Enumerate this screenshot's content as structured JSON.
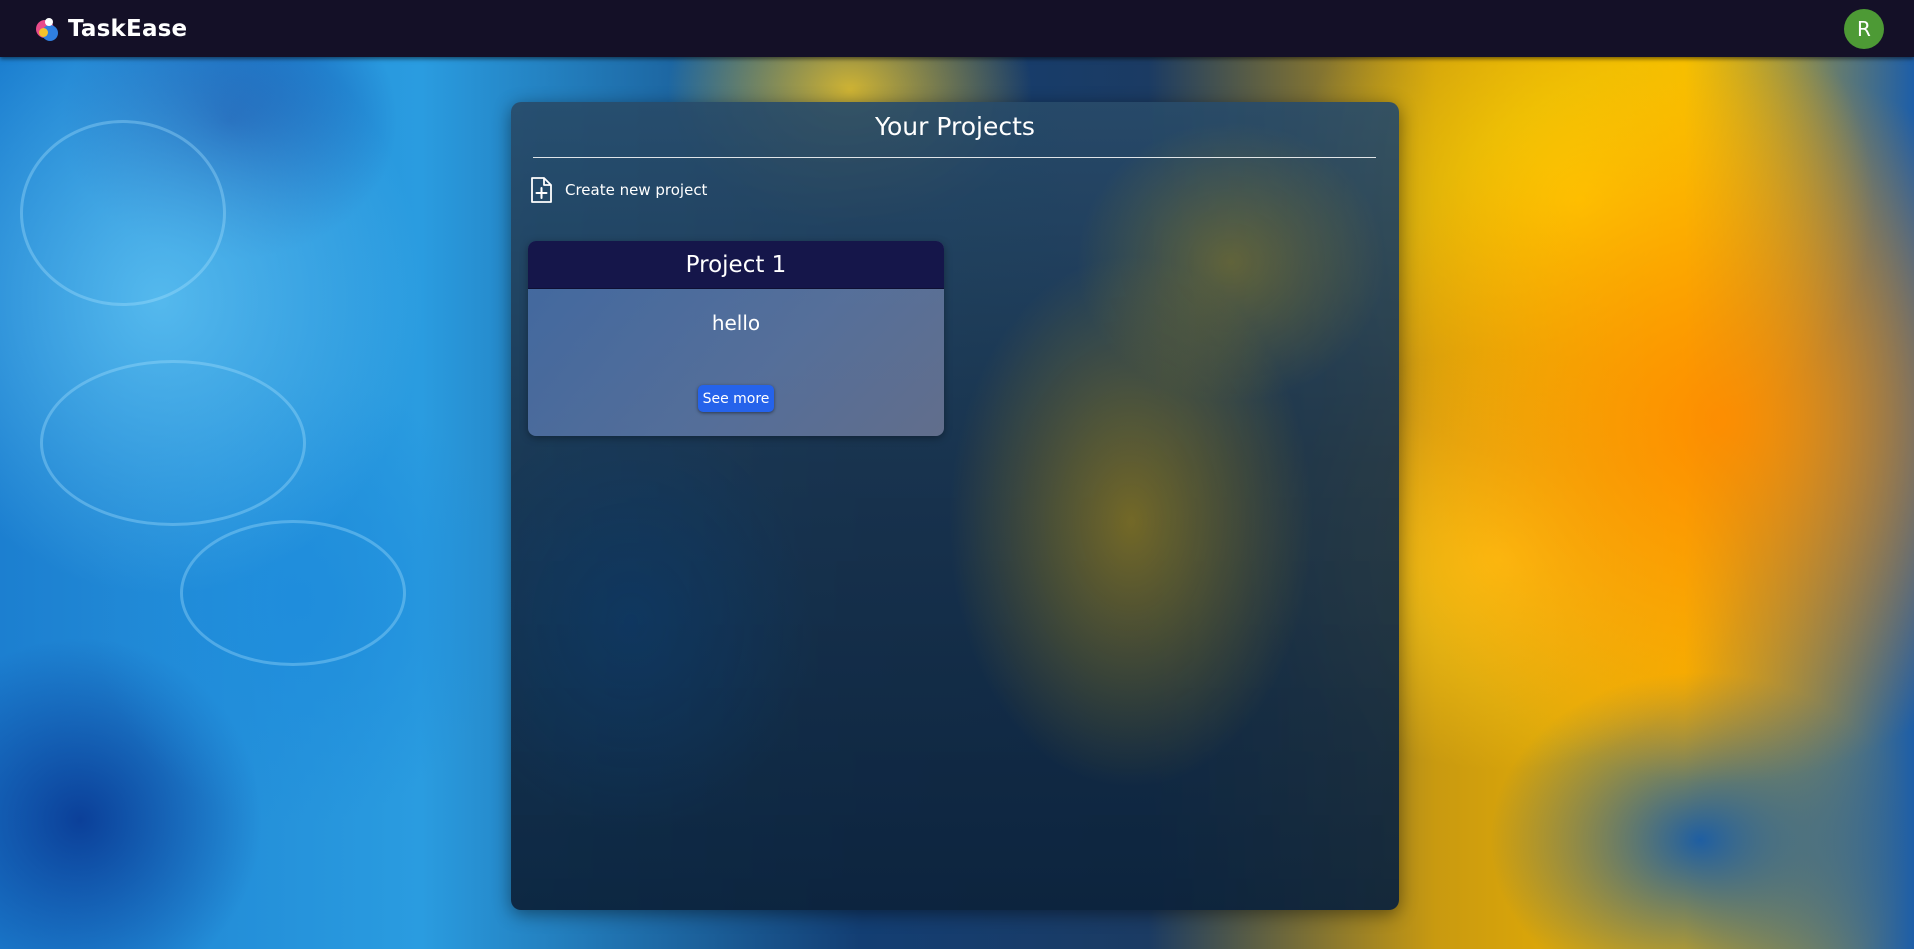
{
  "app": {
    "name": "TaskEase",
    "user_initial": "R",
    "avatar_color": "#4d9a35",
    "navbar_color": "#141027"
  },
  "icons": {
    "logo": "taskease-logo-icon",
    "create": "file-plus-icon"
  },
  "projects_panel": {
    "title": "Your Projects",
    "create_label": "Create new project"
  },
  "projects": [
    {
      "title": "Project 1",
      "description": "hello",
      "button_label": "See more"
    }
  ],
  "colors": {
    "card_header": "#15164a",
    "button": "#2563eb"
  }
}
